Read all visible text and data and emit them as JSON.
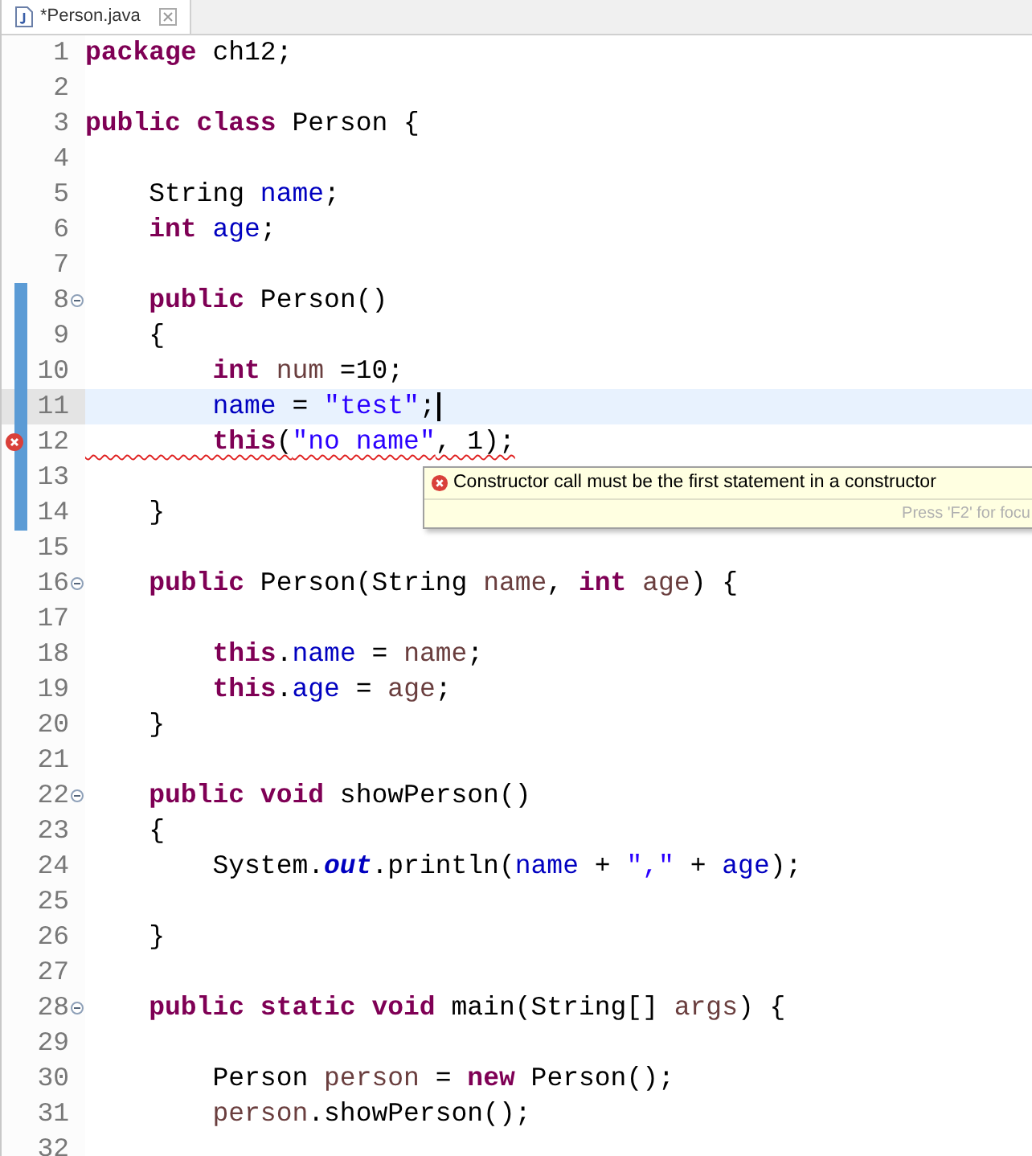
{
  "tab": {
    "title": "*Person.java",
    "selected": true
  },
  "lines": [
    {
      "number": "1",
      "fold": false,
      "changed": false,
      "error": false,
      "current": false,
      "tokens": [
        {
          "kind": "keyword",
          "text": "package"
        },
        {
          "kind": "plain",
          "text": " ch12;"
        }
      ]
    },
    {
      "number": "2",
      "fold": false,
      "changed": false,
      "error": false,
      "current": false
    },
    {
      "number": "3",
      "fold": false,
      "changed": false,
      "error": false,
      "current": false,
      "tokens": [
        {
          "kind": "keyword",
          "text": "public class"
        },
        {
          "kind": "plain",
          "text": " Person {"
        }
      ]
    },
    {
      "number": "4",
      "fold": false,
      "changed": false,
      "error": false,
      "current": false
    },
    {
      "number": "5",
      "fold": false,
      "changed": false,
      "error": false,
      "current": false,
      "tokens": [
        {
          "kind": "plain",
          "text": "    String "
        },
        {
          "kind": "field",
          "text": "name"
        },
        {
          "kind": "plain",
          "text": ";"
        }
      ]
    },
    {
      "number": "6",
      "fold": false,
      "changed": false,
      "error": false,
      "current": false,
      "tokens": [
        {
          "kind": "keyword",
          "text": "    int"
        },
        {
          "kind": "field",
          "text": " age"
        },
        {
          "kind": "plain",
          "text": ";"
        }
      ]
    },
    {
      "number": "7",
      "fold": false,
      "changed": false,
      "error": false,
      "current": false
    },
    {
      "number": "8",
      "fold": true,
      "changed": true,
      "error": false,
      "current": false,
      "tokens": [
        {
          "kind": "keyword",
          "text": "    public"
        },
        {
          "kind": "plain",
          "text": " Person()"
        }
      ]
    },
    {
      "number": "9",
      "fold": false,
      "changed": true,
      "error": false,
      "current": false,
      "tokens": [
        {
          "kind": "plain",
          "text": "    {"
        }
      ]
    },
    {
      "number": "10",
      "fold": false,
      "changed": true,
      "error": false,
      "current": false,
      "tokens": [
        {
          "kind": "keyword",
          "text": "        int"
        },
        {
          "kind": "local",
          "text": " num"
        },
        {
          "kind": "plain",
          "text": " =10;"
        }
      ]
    },
    {
      "number": "11",
      "fold": false,
      "changed": true,
      "error": false,
      "current": true,
      "tokens": [
        {
          "kind": "field",
          "text": "        name"
        },
        {
          "kind": "plain",
          "text": " = "
        },
        {
          "kind": "string",
          "text": "\"test\""
        },
        {
          "kind": "plain",
          "text": ";"
        }
      ]
    },
    {
      "number": "12",
      "fold": false,
      "changed": true,
      "error": true,
      "current": false,
      "tokens": [
        {
          "kind": "keyword",
          "text": "        this"
        },
        {
          "kind": "plain",
          "text": "("
        },
        {
          "kind": "string",
          "text": "\"no name\""
        },
        {
          "kind": "plain",
          "text": ", 1);"
        }
      ]
    },
    {
      "number": "13",
      "fold": false,
      "changed": true,
      "error": false,
      "current": false
    },
    {
      "number": "14",
      "fold": false,
      "changed": true,
      "error": false,
      "current": false,
      "tokens": [
        {
          "kind": "plain",
          "text": "    }"
        }
      ]
    },
    {
      "number": "15",
      "fold": false,
      "changed": false,
      "error": false,
      "current": false
    },
    {
      "number": "16",
      "fold": true,
      "changed": false,
      "error": false,
      "current": false,
      "tokens": [
        {
          "kind": "keyword",
          "text": "    public"
        },
        {
          "kind": "plain",
          "text": " Person(String "
        },
        {
          "kind": "local",
          "text": "name"
        },
        {
          "kind": "plain",
          "text": ", "
        },
        {
          "kind": "keyword",
          "text": "int"
        },
        {
          "kind": "local",
          "text": " age"
        },
        {
          "kind": "plain",
          "text": ") {"
        }
      ]
    },
    {
      "number": "17",
      "fold": false,
      "changed": false,
      "error": false,
      "current": false
    },
    {
      "number": "18",
      "fold": false,
      "changed": false,
      "error": false,
      "current": false,
      "tokens": [
        {
          "kind": "keyword",
          "text": "        this"
        },
        {
          "kind": "plain",
          "text": "."
        },
        {
          "kind": "field",
          "text": "name"
        },
        {
          "kind": "plain",
          "text": " = "
        },
        {
          "kind": "local",
          "text": "name"
        },
        {
          "kind": "plain",
          "text": ";"
        }
      ]
    },
    {
      "number": "19",
      "fold": false,
      "changed": false,
      "error": false,
      "current": false,
      "tokens": [
        {
          "kind": "keyword",
          "text": "        this"
        },
        {
          "kind": "plain",
          "text": "."
        },
        {
          "kind": "field",
          "text": "age"
        },
        {
          "kind": "plain",
          "text": " = "
        },
        {
          "kind": "local",
          "text": "age"
        },
        {
          "kind": "plain",
          "text": ";"
        }
      ]
    },
    {
      "number": "20",
      "fold": false,
      "changed": false,
      "error": false,
      "current": false,
      "tokens": [
        {
          "kind": "plain",
          "text": "    }"
        }
      ]
    },
    {
      "number": "21",
      "fold": false,
      "changed": false,
      "error": false,
      "current": false
    },
    {
      "number": "22",
      "fold": true,
      "changed": false,
      "error": false,
      "current": false,
      "tokens": [
        {
          "kind": "keyword",
          "text": "    public void"
        },
        {
          "kind": "plain",
          "text": " showPerson()"
        }
      ]
    },
    {
      "number": "23",
      "fold": false,
      "changed": false,
      "error": false,
      "current": false,
      "tokens": [
        {
          "kind": "plain",
          "text": "    {"
        }
      ]
    },
    {
      "number": "24",
      "fold": false,
      "changed": false,
      "error": false,
      "current": false,
      "tokens": [
        {
          "kind": "plain",
          "text": "        System."
        },
        {
          "kind": "static_field",
          "text": "out"
        },
        {
          "kind": "plain",
          "text": ".println("
        },
        {
          "kind": "field",
          "text": "name"
        },
        {
          "kind": "plain",
          "text": " + "
        },
        {
          "kind": "string",
          "text": "\",\""
        },
        {
          "kind": "plain",
          "text": " + "
        },
        {
          "kind": "field",
          "text": "age"
        },
        {
          "kind": "plain",
          "text": ");"
        }
      ]
    },
    {
      "number": "25",
      "fold": false,
      "changed": false,
      "error": false,
      "current": false
    },
    {
      "number": "26",
      "fold": false,
      "changed": false,
      "error": false,
      "current": false,
      "tokens": [
        {
          "kind": "plain",
          "text": "    }"
        }
      ]
    },
    {
      "number": "27",
      "fold": false,
      "changed": false,
      "error": false,
      "current": false
    },
    {
      "number": "28",
      "fold": true,
      "changed": false,
      "error": false,
      "current": false,
      "tokens": [
        {
          "kind": "keyword",
          "text": "    public static void"
        },
        {
          "kind": "plain",
          "text": " main(String[] "
        },
        {
          "kind": "local",
          "text": "args"
        },
        {
          "kind": "plain",
          "text": ") {"
        }
      ]
    },
    {
      "number": "29",
      "fold": false,
      "changed": false,
      "error": false,
      "current": false
    },
    {
      "number": "30",
      "fold": false,
      "changed": false,
      "error": false,
      "current": false,
      "tokens": [
        {
          "kind": "plain",
          "text": "        Person "
        },
        {
          "kind": "local",
          "text": "person"
        },
        {
          "kind": "plain",
          "text": " = "
        },
        {
          "kind": "keyword",
          "text": "new"
        },
        {
          "kind": "plain",
          "text": " Person();"
        }
      ]
    },
    {
      "number": "31",
      "fold": false,
      "changed": false,
      "error": false,
      "current": false,
      "tokens": [
        {
          "kind": "local",
          "text": "        person"
        },
        {
          "kind": "plain",
          "text": ".showPerson();"
        }
      ]
    },
    {
      "number": "32",
      "fold": false,
      "changed": false,
      "error": false,
      "current": false
    }
  ],
  "tooltip": {
    "message": "Constructor call must be the first statement in a constructor",
    "hint": "Press 'F2' for focu"
  }
}
